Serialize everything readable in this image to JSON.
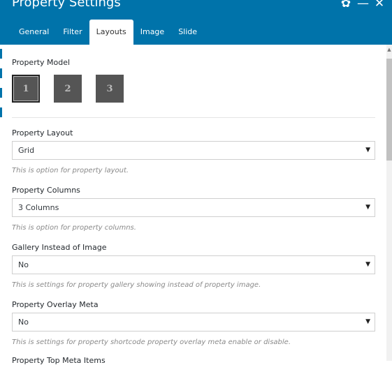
{
  "header": {
    "title": "Property Settings",
    "icons": [
      "gear-icon",
      "minimize-icon",
      "close-icon"
    ],
    "glyphs": {
      "gear": "✿",
      "minimize": "—",
      "close": "✕"
    }
  },
  "tabs": [
    {
      "label": "General",
      "active": false
    },
    {
      "label": "Filter",
      "active": false
    },
    {
      "label": "Layouts",
      "active": true
    },
    {
      "label": "Image",
      "active": false
    },
    {
      "label": "Slide",
      "active": false
    }
  ],
  "model": {
    "label": "Property Model",
    "options": [
      "1",
      "2",
      "3"
    ],
    "selected": "1"
  },
  "fields": [
    {
      "label": "Property Layout",
      "value": "Grid",
      "hint": "This is option for property layout."
    },
    {
      "label": "Property Columns",
      "value": "3 Columns",
      "hint": "This is option for property columns."
    },
    {
      "label": "Gallery Instead of Image",
      "value": "No",
      "hint": "This is settings for property gallery showing instead of property image."
    },
    {
      "label": "Property Overlay Meta",
      "value": "No",
      "hint": "This is settings for property shortcode property overlay meta enable or disable."
    },
    {
      "label": "Property Top Meta Items",
      "value": "",
      "hint": ""
    }
  ],
  "select_arrow": "▼",
  "colors": {
    "header": "#0073aa",
    "model_button": "#555555"
  }
}
